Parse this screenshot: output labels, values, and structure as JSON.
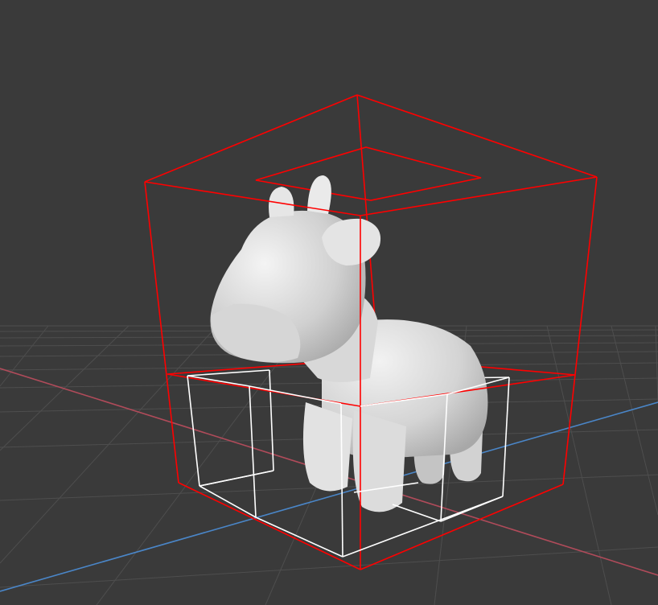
{
  "viewport": {
    "background_color": "#3a3a3a",
    "grid_color": "#4e4e4e",
    "x_axis_color": "#b04b5a",
    "z_axis_color": "#4a86c8"
  },
  "scene": {
    "object": "cow",
    "object_color": "#dedede",
    "bounding_box_color": "#ff0000",
    "sub_box_color": "#ffffff"
  }
}
